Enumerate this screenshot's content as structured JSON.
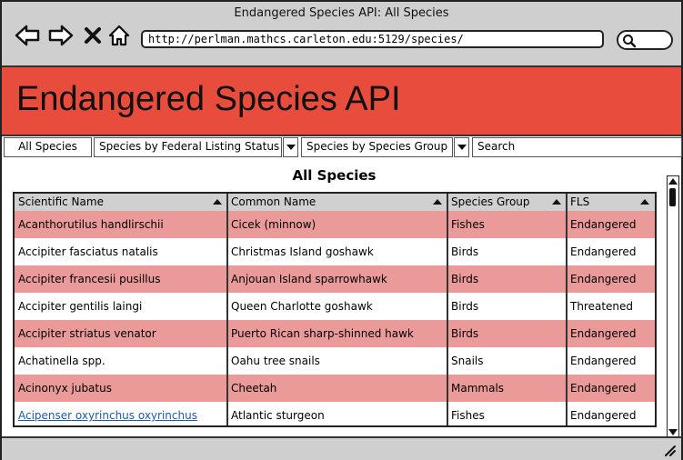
{
  "window": {
    "title": "Endangered Species API: All Species"
  },
  "browser": {
    "url": "http://perlman.mathcs.carleton.edu:5129/species/",
    "icons": [
      "back-arrow-icon",
      "forward-arrow-icon",
      "close-x-icon",
      "home-icon",
      "search-icon"
    ]
  },
  "banner": {
    "title": "Endangered Species API",
    "color": "#e84c3d"
  },
  "toolbar": {
    "all_species": "All Species",
    "by_status": "Species by Federal Listing Status",
    "by_group": "Species by Species Group",
    "search_placeholder": "Search"
  },
  "table": {
    "title": "All Species",
    "columns": [
      "Scientific Name",
      "Common Name",
      "Species Group",
      "FLS"
    ],
    "rows": [
      [
        "Acanthorutilus handlirschii",
        "Cicek (minnow)",
        "Fishes",
        "Endangered"
      ],
      [
        "Accipiter fasciatus natalis",
        "Christmas Island goshawk",
        "Birds",
        "Endangered"
      ],
      [
        "Accipiter francesii pusillus",
        "Anjouan Island sparrowhawk",
        "Birds",
        "Endangered"
      ],
      [
        "Accipiter gentilis laingi",
        "Queen Charlotte goshawk",
        "Birds",
        "Threatened"
      ],
      [
        "Accipiter striatus venator",
        "Puerto Rican sharp-shinned hawk",
        "Birds",
        "Endangered"
      ],
      [
        "Achatinella spp.",
        "Oahu tree snails",
        "Snails",
        "Endangered"
      ],
      [
        "Acinonyx jubatus",
        "Cheetah",
        "Mammals",
        "Endangered"
      ],
      [
        "Acipenser oxyrinchus oxyrinchus",
        "Atlantic sturgeon",
        "Fishes",
        "Endangered"
      ]
    ],
    "highlight_color": "#ea9a99",
    "link_row_index": 7
  }
}
